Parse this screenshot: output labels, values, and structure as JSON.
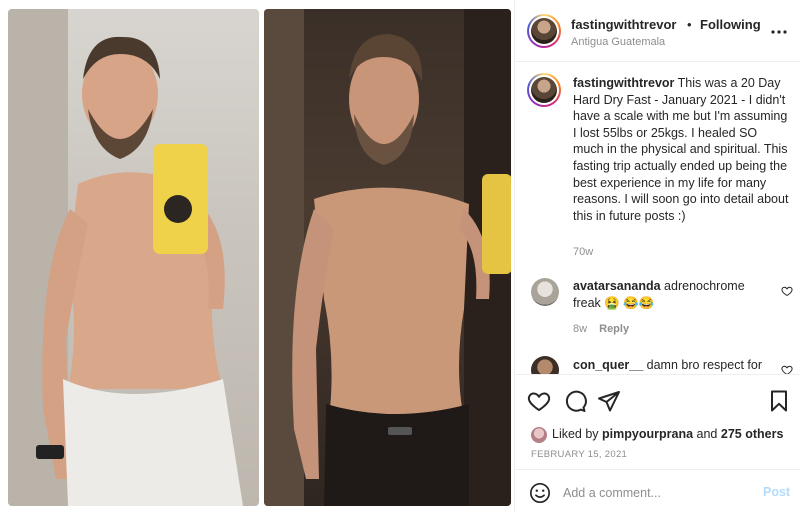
{
  "post": {
    "username": "fastingwithtrevor",
    "separator": "•",
    "follow_status": "Following",
    "location": "Antigua Guatemala"
  },
  "caption": {
    "username": "fastingwithtrevor",
    "text": "This was a 20 Day Hard Dry Fast - January 2021 - I didn't have a scale with me but I'm assuming I lost 55lbs or 25kgs. I healed SO much in the physical and spiritual. This fasting trip actually ended up being the best experience in my life for many reasons. I will soon go into detail about this in future posts :)",
    "time": "70w"
  },
  "comments": [
    {
      "username": "avatarsananda",
      "text": "adrenochrome freak 🤮 😂😂",
      "time": "8w",
      "reply_label": "Reply"
    },
    {
      "username": "con_quer__",
      "text": "damn bro respect for"
    }
  ],
  "likes": {
    "prefix": "Liked by",
    "user": "pimpyourprana",
    "connector": "and",
    "others": "275 others"
  },
  "date": "FEBRUARY 15, 2021",
  "add_comment": {
    "placeholder": "Add a comment...",
    "post_label": "Post"
  },
  "icons": {
    "more": "more-horizontal-icon",
    "like": "heart-icon",
    "comment": "comment-bubble-icon",
    "share": "paper-plane-icon",
    "save": "bookmark-icon",
    "emoji": "smiley-icon"
  },
  "colors": {
    "link_disabled": "#b3dbff",
    "muted": "#8e8e8e",
    "text": "#262626"
  }
}
